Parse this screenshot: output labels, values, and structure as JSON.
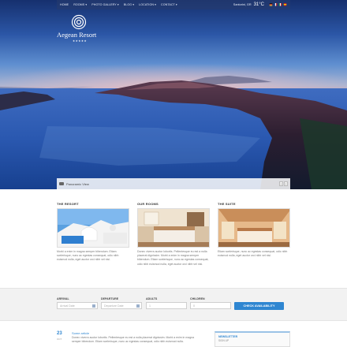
{
  "nav": {
    "items": [
      "Home",
      "Rooms ▾",
      "Photo Gallery ▾",
      "Blog ▾",
      "Location ▾",
      "Contact ▾"
    ],
    "location": "Santorini, GR",
    "temperature": "31°C",
    "flags": [
      {
        "name": "flag-de",
        "colors": [
          "#1a1a1a",
          "#d0312d",
          "#f2c12e"
        ]
      },
      {
        "name": "flag-fr",
        "colors": [
          "#2a4aa0",
          "#ffffff",
          "#d0312d"
        ]
      },
      {
        "name": "flag-it",
        "colors": [
          "#2e8b47",
          "#ffffff",
          "#d0312d"
        ]
      },
      {
        "name": "flag-es",
        "colors": [
          "#c8102e",
          "#f5c400",
          "#c8102e"
        ]
      }
    ]
  },
  "logo": {
    "name": "Aegean Resort",
    "stars": "★★★★★"
  },
  "hero": {
    "caption": "Panoramic View",
    "prev": "‹",
    "next": "›"
  },
  "columns": [
    {
      "title": "The Resort",
      "text": "Morbi a enim in magna semper bibendum. Etiam scelerisque, nunc ac egestas consequat, odio nibh euismod nulla, eget auctor orci nibh vel nisi."
    },
    {
      "title": "Our Rooms",
      "text": "Donec viverra auctor lobortis. Pellentesque eu est a nulla placerat dignissim. Morbi a enim in magna semper bibendum. Etiam scelerisque, nunc ac egestas consequat, odio nibh euismod nulla, eget auctor orci nibh vel nisi."
    },
    {
      "title": "The Suite",
      "text": "Etiam scelerisque, nunc ac egestas consequat, odio nibh euismod nulla, eget auctor orci nibh vel nisi."
    }
  ],
  "booking": {
    "arrival_label": "Arrival",
    "arrival_placeholder": "Arrival Date",
    "departure_label": "Departure",
    "departure_placeholder": "Departure Date",
    "adults_label": "Adults",
    "adults_value": "1",
    "children_label": "Children",
    "children_value": "0",
    "button": "Check Availability"
  },
  "article": {
    "day": "23",
    "month": "Oct",
    "title": "Some article",
    "body": "Donec viverra auctor lobortis. Pellentesque eu est a nulla placerat dignissim. Morbi a enim in magna semper bibendum. Etiam scelerisque, nunc ac egestas consequat, odio nibh euismod nulla."
  },
  "newsletter": {
    "title": "Newsletter",
    "subtitle": "Sign up"
  },
  "colors": {
    "accent": "#2f86d1",
    "nav_bg": "#283c6e"
  }
}
